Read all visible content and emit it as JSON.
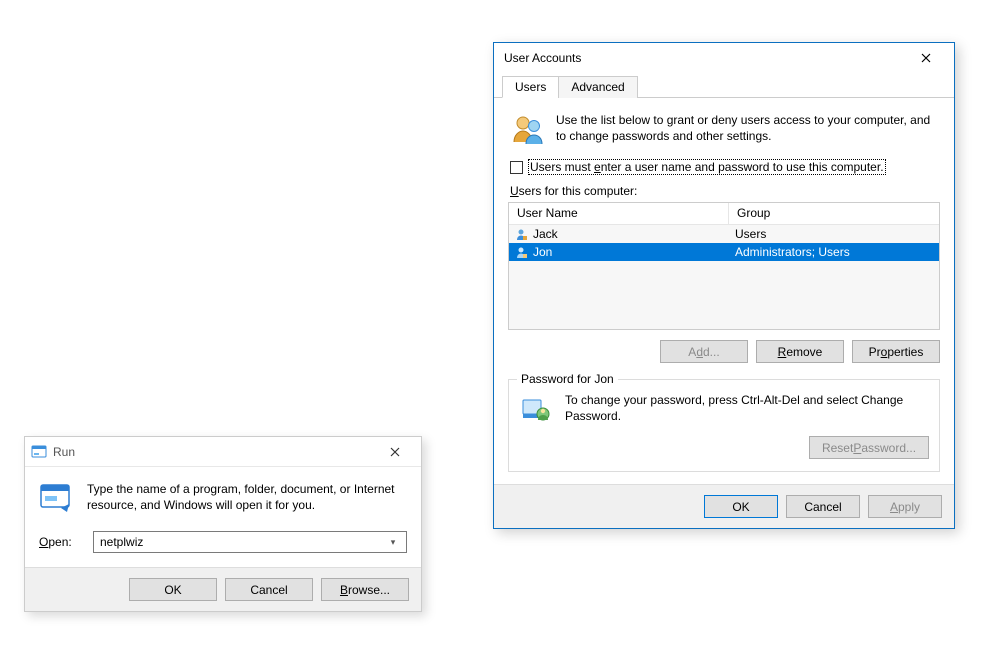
{
  "run": {
    "title": "Run",
    "description": "Type the name of a program, folder, document, or Internet resource, and Windows will open it for you.",
    "open_label": "Open:",
    "open_value": "netplwiz",
    "buttons": {
      "ok": "OK",
      "cancel": "Cancel",
      "browse": "Browse..."
    }
  },
  "ua": {
    "title": "User Accounts",
    "tabs": {
      "users": "Users",
      "advanced": "Advanced"
    },
    "intro": "Use the list below to grant or deny users access to your computer, and to change passwords and other settings.",
    "require_login_label": "Users must enter a user name and password to use this computer.",
    "users_for_label": "Users for this computer:",
    "columns": {
      "username": "User Name",
      "group": "Group"
    },
    "rows": [
      {
        "username": "Jack",
        "group": "Users",
        "selected": false
      },
      {
        "username": "Jon",
        "group": "Administrators; Users",
        "selected": true
      }
    ],
    "buttons": {
      "add": "Add...",
      "remove": "Remove",
      "properties": "Properties"
    },
    "password_box": {
      "legend": "Password for Jon",
      "text": "To change your password, press Ctrl-Alt-Del and select Change Password.",
      "reset": "Reset Password..."
    },
    "bottom": {
      "ok": "OK",
      "cancel": "Cancel",
      "apply": "Apply"
    }
  }
}
